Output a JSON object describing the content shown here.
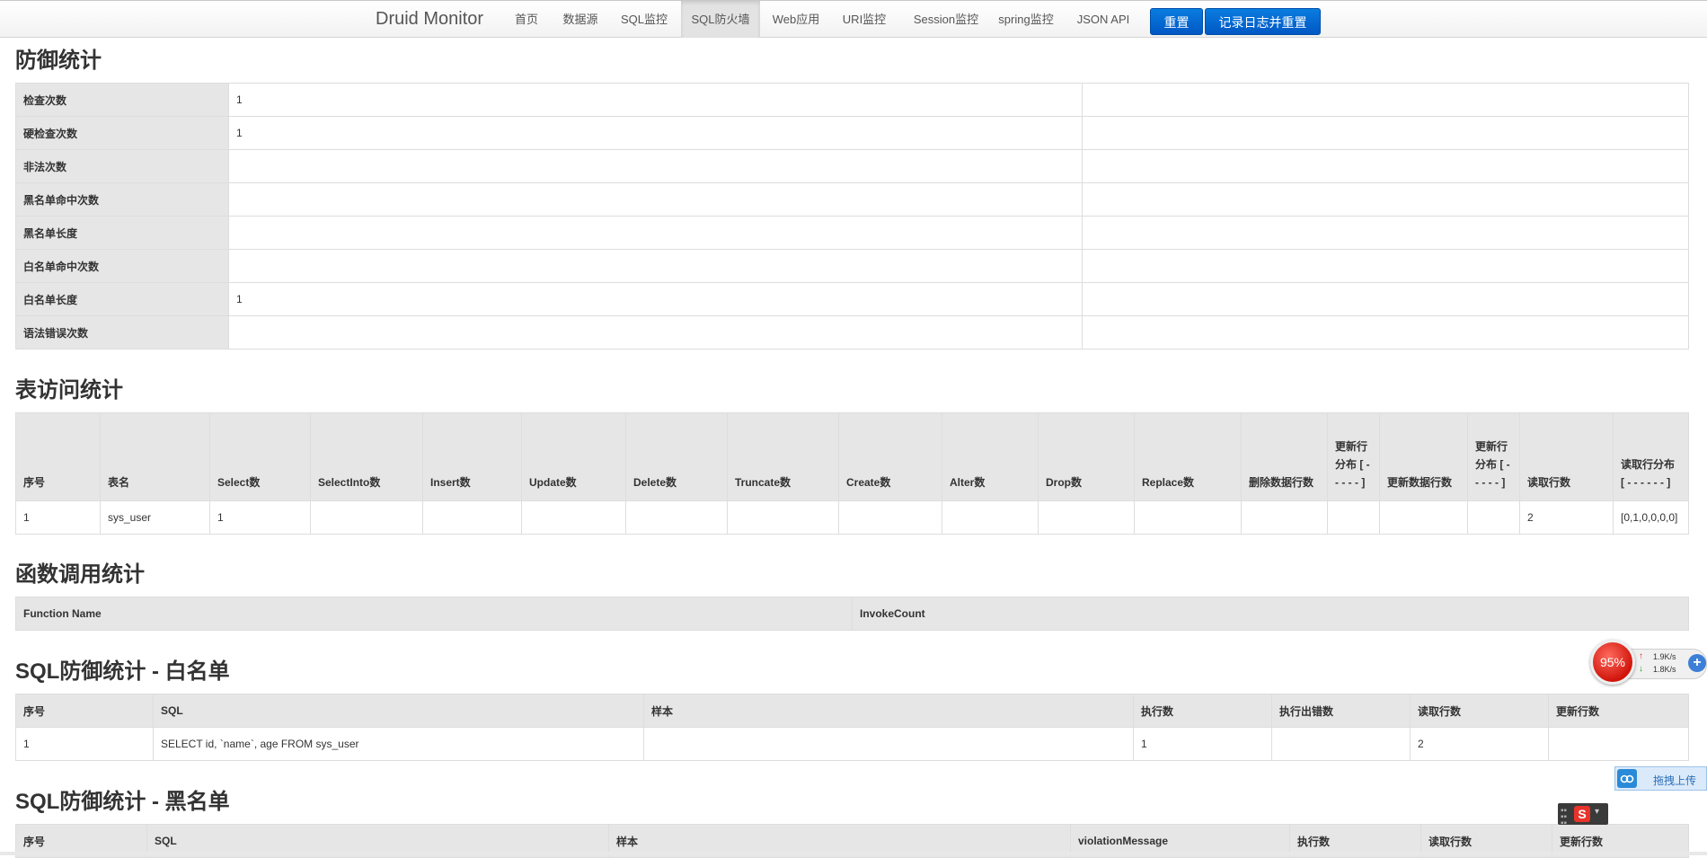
{
  "navbar": {
    "brand": "Druid Monitor",
    "items": [
      {
        "label": "首页",
        "active": false
      },
      {
        "label": "数据源",
        "active": false
      },
      {
        "label": "SQL监控",
        "active": false
      },
      {
        "label": "SQL防火墙",
        "active": true
      },
      {
        "label": "Web应用",
        "active": false
      },
      {
        "label": "URI监控",
        "active": false
      },
      {
        "label": "Session监控",
        "active": false
      },
      {
        "label": "spring监控",
        "active": false
      },
      {
        "label": "JSON API",
        "active": false
      }
    ],
    "reset_button": "重置",
    "log_reset_button": "记录日志并重置"
  },
  "defense_stats": {
    "title": "防御统计",
    "rows": [
      {
        "label": "检查次数",
        "value": "1"
      },
      {
        "label": "硬检查次数",
        "value": "1"
      },
      {
        "label": "非法次数",
        "value": ""
      },
      {
        "label": "黑名单命中次数",
        "value": ""
      },
      {
        "label": "黑名单长度",
        "value": ""
      },
      {
        "label": "白名单命中次数",
        "value": ""
      },
      {
        "label": "白名单长度",
        "value": "1"
      },
      {
        "label": "语法错误次数",
        "value": ""
      }
    ]
  },
  "table_access": {
    "title": "表访问统计",
    "headers": [
      "序号",
      "表名",
      "Select数",
      "SelectInto数",
      "Insert数",
      "Update数",
      "Delete数",
      "Truncate数",
      "Create数",
      "Alter数",
      "Drop数",
      "Replace数",
      "删除数据行数",
      "更新行分布 [ - - - - - ]",
      "更新数据行数",
      "更新行分布 [ - - - - - ]",
      "读取行数",
      "读取行分布 [ - - - - - - ]"
    ],
    "rows": [
      [
        "1",
        "sys_user",
        "1",
        "",
        "",
        "",
        "",
        "",
        "",
        "",
        "",
        "",
        "",
        "",
        "",
        "",
        "2",
        "[0,1,0,0,0,0]"
      ]
    ]
  },
  "function_stats": {
    "title": "函数调用统计",
    "headers": [
      "Function Name",
      "InvokeCount"
    ]
  },
  "whitelist": {
    "title": "SQL防御统计 - 白名单",
    "headers": [
      "序号",
      "SQL",
      "样本",
      "执行数",
      "执行出错数",
      "读取行数",
      "更新行数"
    ],
    "rows": [
      [
        "1",
        "SELECT id, `name`, age FROM sys_user",
        "",
        "1",
        "",
        "2",
        ""
      ]
    ]
  },
  "blacklist": {
    "title": "SQL防御统计 - 黑名单",
    "headers": [
      "序号",
      "SQL",
      "样本",
      "violationMessage",
      "执行数",
      "读取行数",
      "更新行数"
    ]
  },
  "speed_widget": {
    "percent": "95%",
    "upload": "1.9K/s",
    "download": "1.8K/s"
  },
  "upload_tab": {
    "label": "拖拽上传"
  },
  "colors": {
    "accent": "#0a6fd8",
    "header_bg": "#e6e6e6",
    "border": "#dddddd"
  },
  "icons": [
    "cloud-upload-icon",
    "sogou-ime-icon",
    "plus-icon",
    "arrow-up-icon",
    "arrow-down-icon"
  ]
}
